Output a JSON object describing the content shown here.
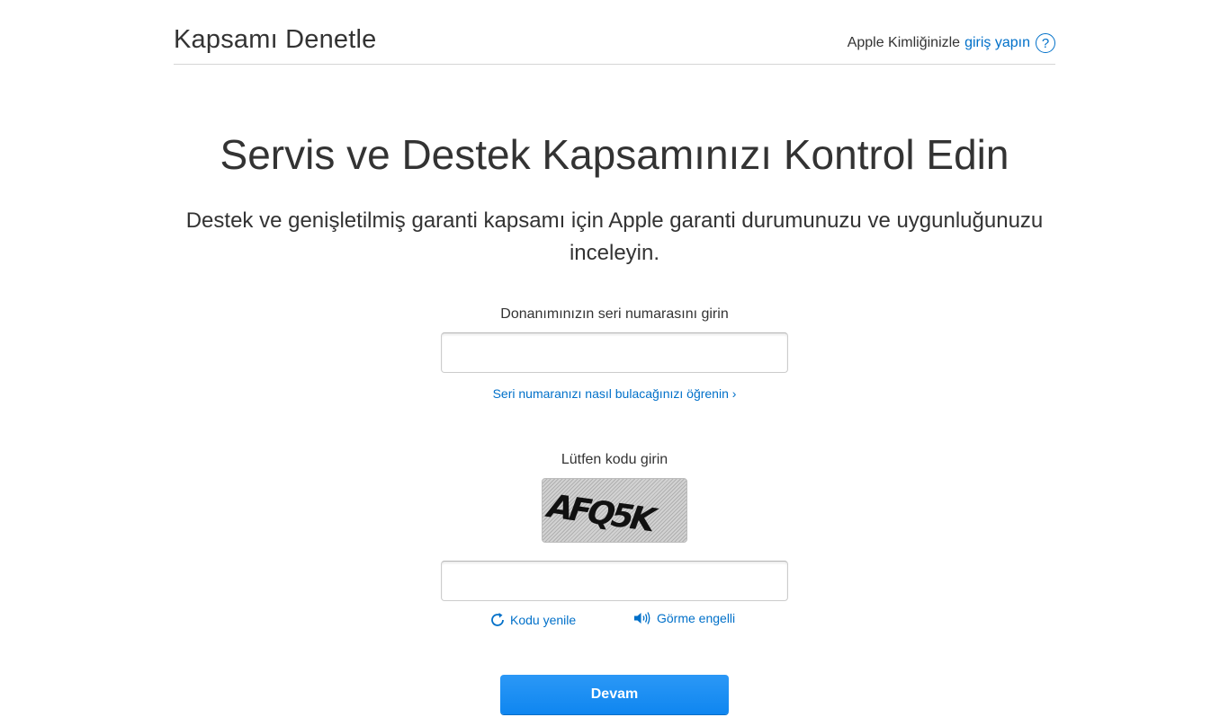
{
  "header": {
    "title": "Kapsamı Denetle",
    "signin_prefix": "Apple Kimliğinizle",
    "signin_link": "giriş yapın",
    "help_symbol": "?"
  },
  "hero": {
    "title": "Servis ve Destek Kapsamınızı Kontrol Edin",
    "subtitle": "Destek ve genişletilmiş garanti kapsamı için Apple garanti durumunuzu ve uygunluğunuzu inceleyin."
  },
  "serial": {
    "label": "Donanımınızın seri numarasını girin",
    "value": "",
    "help_link": "Seri numaranızı nasıl bulacağınızı öğrenin ›"
  },
  "captcha": {
    "label": "Lütfen kodu girin",
    "code_image_text": "AFQ5K",
    "value": "",
    "refresh_label": "Kodu yenile",
    "accessibility_label": "Görme engelli"
  },
  "actions": {
    "continue_label": "Devam"
  },
  "colors": {
    "link": "#0070c9",
    "button": "#1a8cf2",
    "text": "#333333",
    "divider": "#d6d6d6"
  },
  "icons": {
    "help": "question-circle-icon",
    "refresh": "refresh-icon",
    "audio": "speaker-icon"
  }
}
